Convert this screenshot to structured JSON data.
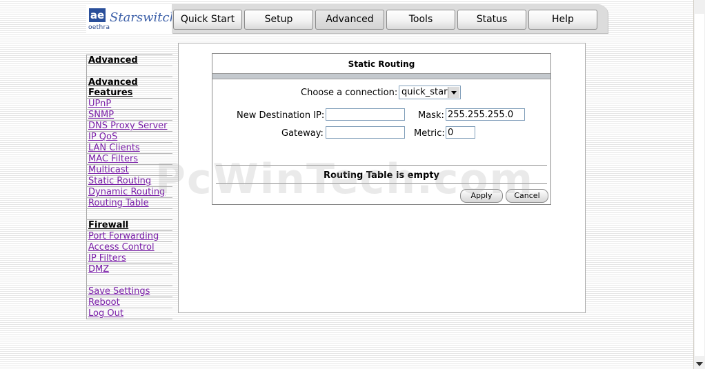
{
  "logo": {
    "mark": "ae",
    "small": "oethra",
    "brand": "Starswitch"
  },
  "tabs": [
    {
      "label": "Quick Start"
    },
    {
      "label": "Setup"
    },
    {
      "label": "Advanced"
    },
    {
      "label": "Tools"
    },
    {
      "label": "Status"
    },
    {
      "label": "Help"
    }
  ],
  "sidebar": {
    "advanced_heading": "Advanced",
    "features_heading": "Advanced Features",
    "features": [
      "UPnP",
      "SNMP",
      "DNS Proxy Server",
      "IP QoS",
      "LAN Clients",
      "MAC Filters",
      "Multicast",
      "Static Routing",
      "Dynamic Routing",
      "Routing Table"
    ],
    "firewall_heading": "Firewall",
    "firewall": [
      "Port Forwarding",
      "Access Control",
      "IP Filters",
      "DMZ"
    ],
    "bottom": [
      "Save Settings",
      "Reboot",
      "Log Out"
    ]
  },
  "panel": {
    "title": "Static Routing",
    "choose_label": "Choose a connection:",
    "connection_value": "quick_start",
    "dest_label": "New Destination IP:",
    "dest_value": "",
    "mask_label": "Mask:",
    "mask_value": "255.255.255.0",
    "gateway_label": "Gateway:",
    "gateway_value": "",
    "metric_label": "Metric:",
    "metric_value": "0",
    "empty_text": "Routing Table is empty",
    "apply_label": "Apply",
    "cancel_label": "Cancel"
  },
  "watermark": "PcWinTech.com"
}
